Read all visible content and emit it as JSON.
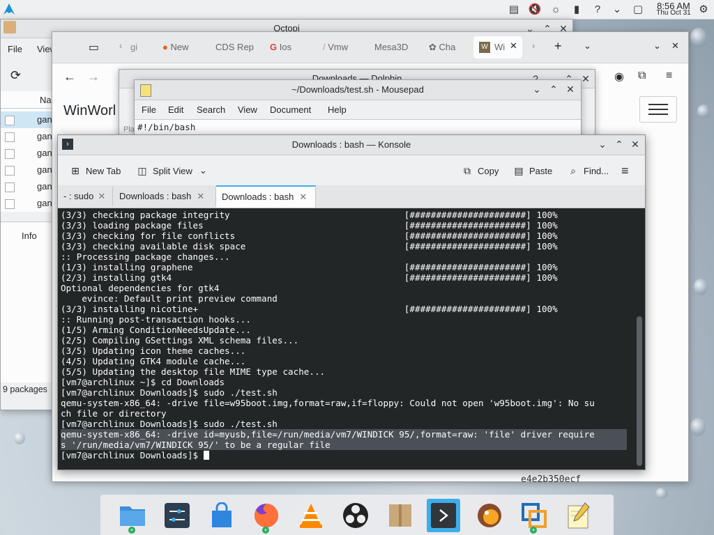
{
  "panel": {
    "time": "8:56 AM",
    "date": "Thu Oct 31"
  },
  "octopi": {
    "title": "Octopi",
    "menu": [
      "File",
      "View"
    ],
    "list_header": "Na",
    "rows": [
      "gan",
      "gan",
      "gan",
      "gan",
      "gan",
      "gan"
    ],
    "info_tab": "Info",
    "status": "9 packages"
  },
  "browser": {
    "tabs": [
      {
        "label": "gi",
        "icon": "chevron-left-icon"
      },
      {
        "label": "New",
        "icon": "firefox-icon"
      },
      {
        "label": "CDS Rep",
        "icon": ""
      },
      {
        "label": "Ios",
        "icon": "google-icon"
      },
      {
        "label": "Vmw",
        "icon": "wand-icon"
      },
      {
        "label": "Mesa3D",
        "icon": ""
      },
      {
        "label": "Cha",
        "icon": "openai-icon"
      },
      {
        "label": "Wi",
        "icon": "winworld-icon"
      }
    ],
    "page_text": "WinWorl",
    "hash_text": "e4e2b350ecf"
  },
  "dolphin": {
    "title": "Downloads — Dolphin",
    "places_label": "Pla"
  },
  "mousepad": {
    "title": "~/Downloads/test.sh - Mousepad",
    "menu": [
      "File",
      "Edit",
      "Search",
      "View",
      "Document",
      "Help"
    ],
    "first_line": "#!/bin/bash"
  },
  "konsole": {
    "title": "Downloads : bash — Konsole",
    "toolbar": {
      "new_tab": "New Tab",
      "split_view": "Split View",
      "copy": "Copy",
      "paste": "Paste",
      "find": "Find..."
    },
    "tabs": [
      "- : sudo",
      "Downloads : bash",
      "Downloads : bash"
    ],
    "active_tab": 2,
    "lines": [
      "(3/3) checking package integrity                                 [######################] 100%",
      "(3/3) loading package files                                      [######################] 100%",
      "(3/3) checking for file conflicts                                [######################] 100%",
      "(3/3) checking available disk space                              [######################] 100%",
      ":: Processing package changes...",
      "(1/3) installing graphene                                        [######################] 100%",
      "(2/3) installing gtk4                                            [######################] 100%",
      "Optional dependencies for gtk4",
      "    evince: Default print preview command",
      "(3/3) installing nicotine+                                       [######################] 100%",
      ":: Running post-transaction hooks...",
      "(1/5) Arming ConditionNeedsUpdate...",
      "(2/5) Compiling GSettings XML schema files...",
      "(3/5) Updating icon theme caches...",
      "(4/5) Updating GTK4 module cache...",
      "(5/5) Updating the desktop file MIME type cache...",
      "[vm7@archlinux ~]$ cd Downloads",
      "[vm7@archlinux Downloads]$ sudo ./test.sh",
      "qemu-system-x86_64: -drive file=w95boot.img,format=raw,if=floppy: Could not open 'w95boot.img': No su",
      "ch file or directory",
      "[vm7@archlinux Downloads]$ sudo ./test.sh",
      "qemu-system-x86_64: -drive id=myusb,file=/run/media/vm7/WINDICK 95/,format=raw: 'file' driver require",
      "s '/run/media/vm7/WINDICK 95/' to be a regular file",
      "[vm7@archlinux Downloads]$ "
    ],
    "highlight_lines": [
      21,
      22
    ]
  },
  "taskbar": {
    "apps": [
      "files-icon",
      "settings-icon",
      "store-icon",
      "firefox-icon",
      "vlc-icon",
      "obs-icon",
      "archive-icon",
      "konsole-icon",
      "octopi-icon",
      "virtualbox-icon",
      "mousepad-icon"
    ],
    "active": "konsole-icon"
  },
  "colors": {
    "accent": "#3daee9",
    "terminal_bg": "#232627",
    "terminal_fg": "#fcfcfc"
  }
}
